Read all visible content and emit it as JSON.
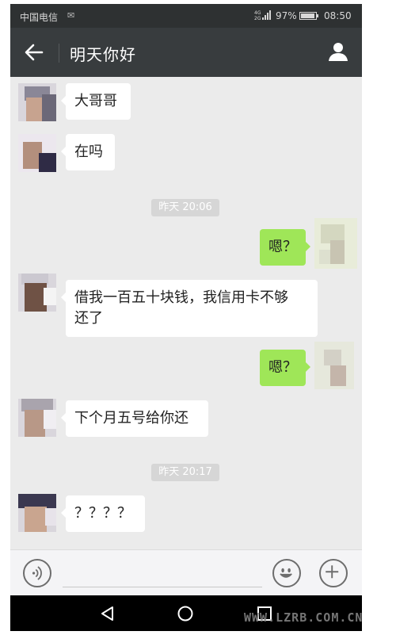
{
  "status_bar": {
    "carrier": "中国电信",
    "network": "4G 2G",
    "battery": "97%",
    "time": "08:50"
  },
  "header": {
    "title": "明天你好",
    "back_icon": "arrow-left-icon",
    "profile_icon": "person-icon"
  },
  "messages": [
    {
      "side": "left",
      "text": "大哥哥"
    },
    {
      "side": "left",
      "text": "在吗"
    },
    {
      "type": "timestamp",
      "text": "昨天 20:06"
    },
    {
      "side": "right",
      "text": "嗯？"
    },
    {
      "side": "left",
      "text_line1": "借我一百五十块钱，我信用卡不够",
      "text_line2": "还了"
    },
    {
      "side": "right",
      "text": "嗯？"
    },
    {
      "side": "left",
      "text": "下个月五号给你还"
    },
    {
      "type": "timestamp",
      "text": "昨天 20:17"
    },
    {
      "side": "left",
      "text": "？？？？"
    }
  ],
  "input_bar": {
    "voice_icon": "voice-icon",
    "emoji_icon": "emoji-icon",
    "plus_icon": "plus-icon"
  },
  "nav_bar": {
    "back_icon": "triangle-back-icon",
    "home_icon": "circle-home-icon",
    "recent_icon": "square-recent-icon"
  },
  "watermark": "WWW.LZRB.COM.CN",
  "colors": {
    "header_bg": "#383c3e",
    "chat_bg": "#ebebeb",
    "sent_bubble": "#9fe658",
    "received_bubble": "#ffffff"
  }
}
